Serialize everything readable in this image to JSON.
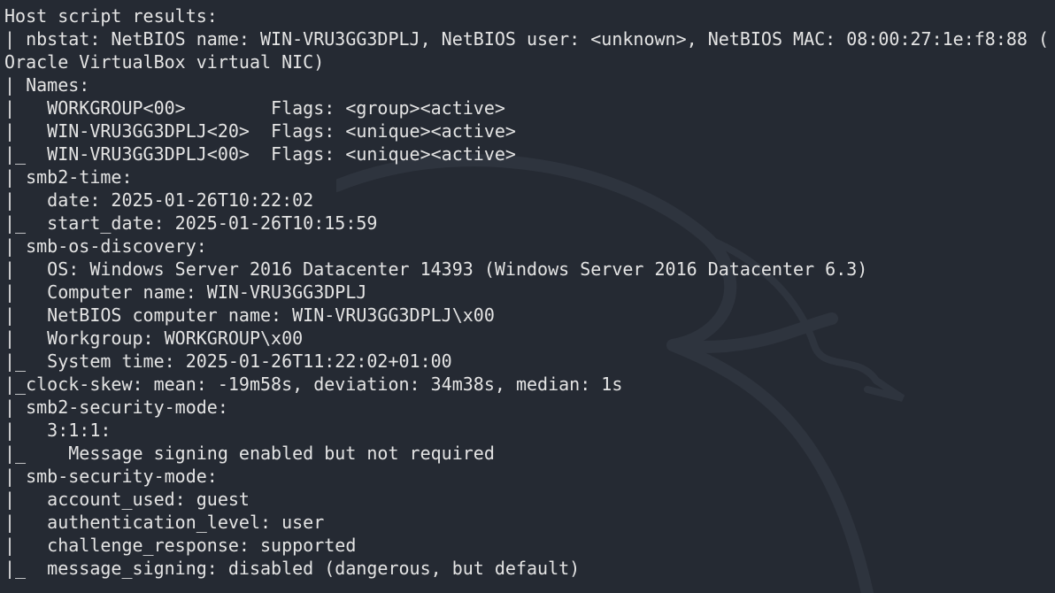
{
  "terminal": {
    "lines": [
      "Host script results:",
      "| nbstat: NetBIOS name: WIN-VRU3GG3DPLJ, NetBIOS user: <unknown>, NetBIOS MAC: 08:00:27:1e:f8:88 (",
      "Oracle VirtualBox virtual NIC)",
      "| Names:",
      "|   WORKGROUP<00>        Flags: <group><active>",
      "|   WIN-VRU3GG3DPLJ<20>  Flags: <unique><active>",
      "|_  WIN-VRU3GG3DPLJ<00>  Flags: <unique><active>",
      "| smb2-time:",
      "|   date: 2025-01-26T10:22:02",
      "|_  start_date: 2025-01-26T10:15:59",
      "| smb-os-discovery:",
      "|   OS: Windows Server 2016 Datacenter 14393 (Windows Server 2016 Datacenter 6.3)",
      "|   Computer name: WIN-VRU3GG3DPLJ",
      "|   NetBIOS computer name: WIN-VRU3GG3DPLJ\\x00",
      "|   Workgroup: WORKGROUP\\x00",
      "|_  System time: 2025-01-26T11:22:02+01:00",
      "|_clock-skew: mean: -19m58s, deviation: 34m38s, median: 1s",
      "| smb2-security-mode:",
      "|   3:1:1:",
      "|_    Message signing enabled but not required",
      "| smb-security-mode:",
      "|   account_used: guest",
      "|   authentication_level: user",
      "|   challenge_response: supported",
      "|_  message_signing: disabled (dangerous, but default)"
    ]
  },
  "colors": {
    "background": "#252a33",
    "text": "#e4e4e4"
  }
}
